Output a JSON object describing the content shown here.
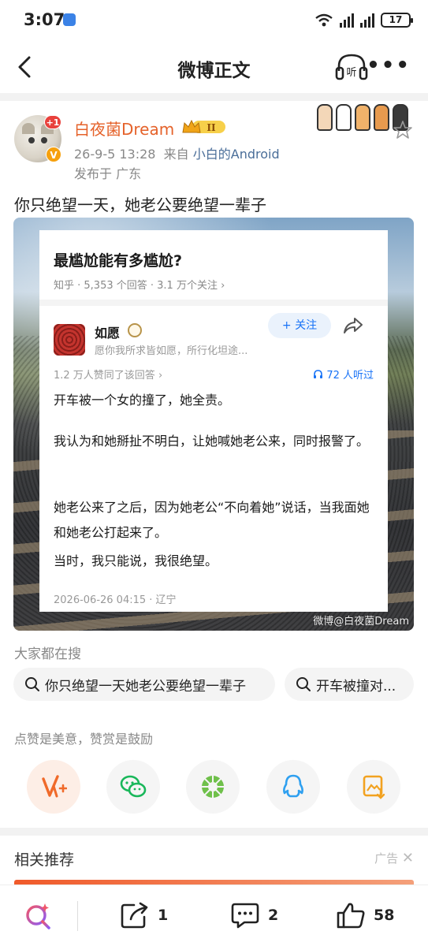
{
  "status_bar": {
    "time": "3:07",
    "battery": "17"
  },
  "nav": {
    "title": "微博正文",
    "listen_label": "听"
  },
  "post": {
    "username": "白夜菌Dream",
    "vip_level": "II",
    "plus_badge": "+1",
    "verified": "V",
    "date": "26-9-5 13:28",
    "source_prefix": "来自",
    "source": "小白的Android",
    "location": "发布于 广东",
    "text": "你只绝望一天，她老公要绝望一辈子"
  },
  "image": {
    "question_title": "最尴尬能有多尴尬?",
    "question_meta": "知乎 · 5,353 个回答 · 3.1 万个关注 ›",
    "answerer_name": "如愿",
    "answerer_bio": "愿你我所求皆如愿，所行化坦途...",
    "follow_label": "+ 关注",
    "likes": "1.2 万人赞同了该回答 ›",
    "listeners": "72 人听过",
    "paragraphs": [
      "开车被一个女的撞了，她全责。",
      "我认为和她掰扯不明白，让她喊她老公来，同时报警了。",
      "她老公来了之后，因为她老公“不向着她”说话，当我面她和她老公打起来了。",
      "当时，我只能说，我很绝望。"
    ],
    "answer_date": "2026-06-26 04:15 · 辽宁",
    "watermark": "微博@白夜菌Dream"
  },
  "searches": {
    "label": "大家都在搜",
    "chips": [
      "你只绝望一天她老公要绝望一辈子",
      "开车被撞对..."
    ]
  },
  "reward": {
    "label": "点赞是美意，赞赏是鼓励",
    "icons": [
      "reward-icon",
      "wechat-icon",
      "moments-icon",
      "qq-icon",
      "save-image-icon"
    ]
  },
  "recommend": {
    "title": "相关推荐",
    "ad_label": "广告"
  },
  "bottom_bar": {
    "repost_count": "1",
    "comment_count": "2",
    "like_count": "58"
  },
  "colors": {
    "brand_orange": "#e5622a",
    "link_blue": "#4a6e99",
    "zhihu_blue": "#1772f6",
    "reward_orange": "#f06a2a"
  }
}
